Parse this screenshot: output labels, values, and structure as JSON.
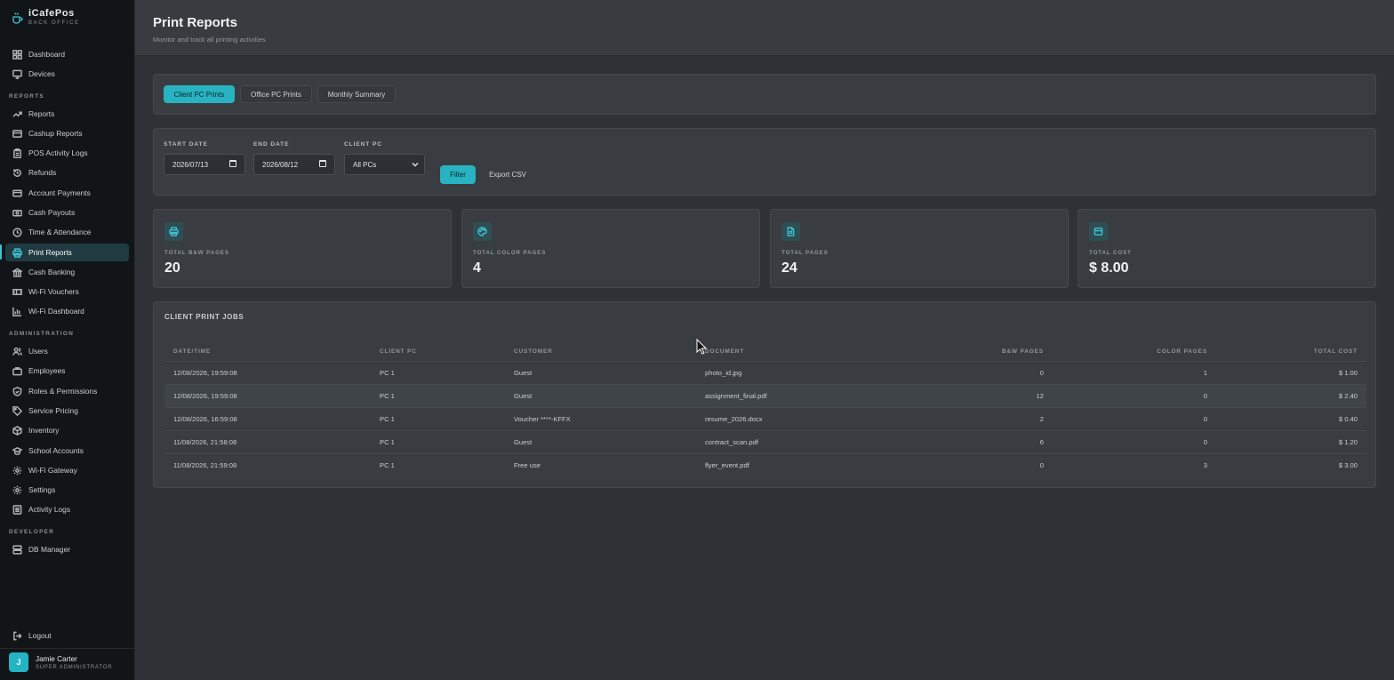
{
  "app": {
    "name": "iCafePos",
    "subtitle": "BACK OFFICE"
  },
  "sidebar": {
    "top_items": [
      {
        "label": "Dashboard",
        "icon": "dashboard-icon"
      },
      {
        "label": "Devices",
        "icon": "monitor-icon"
      }
    ],
    "sections": [
      {
        "label": "REPORTS",
        "items": [
          {
            "label": "Reports",
            "icon": "trending-up-icon"
          },
          {
            "label": "Cashup Reports",
            "icon": "wallet-icon"
          },
          {
            "label": "POS Activity Logs",
            "icon": "clipboard-icon"
          },
          {
            "label": "Refunds",
            "icon": "refund-icon"
          },
          {
            "label": "Account Payments",
            "icon": "credit-card-icon"
          },
          {
            "label": "Cash Payouts",
            "icon": "cash-icon"
          },
          {
            "label": "Time & Attendance",
            "icon": "clock-icon"
          },
          {
            "label": "Print Reports",
            "icon": "printer-icon",
            "active": true
          },
          {
            "label": "Cash Banking",
            "icon": "bank-icon"
          },
          {
            "label": "Wi-Fi Vouchers",
            "icon": "ticket-icon"
          },
          {
            "label": "Wi-Fi Dashboard",
            "icon": "bar-chart-icon"
          }
        ]
      },
      {
        "label": "ADMINISTRATION",
        "items": [
          {
            "label": "Users",
            "icon": "users-icon"
          },
          {
            "label": "Employees",
            "icon": "briefcase-icon"
          },
          {
            "label": "Roles & Permissions",
            "icon": "shield-icon"
          },
          {
            "label": "Service Pricing",
            "icon": "tag-icon"
          },
          {
            "label": "Inventory",
            "icon": "box-icon"
          },
          {
            "label": "School Accounts",
            "icon": "graduation-cap-icon"
          },
          {
            "label": "Wi-Fi Gateway",
            "icon": "gear-icon"
          },
          {
            "label": "Settings",
            "icon": "gear-icon"
          },
          {
            "label": "Activity Logs",
            "icon": "list-icon"
          }
        ]
      },
      {
        "label": "DEVELOPER",
        "items": [
          {
            "label": "DB Manager",
            "icon": "database-icon"
          }
        ]
      }
    ],
    "logout_label": "Logout",
    "user": {
      "initial": "J",
      "name": "Jamie Carter",
      "role": "SUPER ADMINISTRATOR"
    }
  },
  "header": {
    "title": "Print Reports",
    "subtitle": "Monitor and track all printing activities"
  },
  "tabs": [
    {
      "label": "Client PC Prints",
      "active": true
    },
    {
      "label": "Office PC Prints",
      "active": false
    },
    {
      "label": "Monthly Summary",
      "active": false
    }
  ],
  "filters": {
    "start_date": {
      "label": "START DATE",
      "value": "2026/07/13"
    },
    "end_date": {
      "label": "END DATE",
      "value": "2026/08/12"
    },
    "client_pc": {
      "label": "CLIENT PC",
      "value": "All PCs"
    },
    "filter_label": "Filter",
    "export_label": "Export CSV"
  },
  "stats": [
    {
      "label": "TOTAL B&W PAGES",
      "value": "20",
      "icon": "printer-icon"
    },
    {
      "label": "TOTAL COLOR PAGES",
      "value": "4",
      "icon": "palette-icon"
    },
    {
      "label": "TOTAL PAGES",
      "value": "24",
      "icon": "file-icon"
    },
    {
      "label": "TOTAL COST",
      "value": "$ 8.00",
      "icon": "wallet-icon"
    }
  ],
  "table": {
    "title": "CLIENT PRINT JOBS",
    "columns": [
      "DATE/TIME",
      "CLIENT PC",
      "CUSTOMER",
      "DOCUMENT",
      "B&W PAGES",
      "COLOR PAGES",
      "TOTAL COST"
    ],
    "rows": [
      [
        "12/08/2026, 19:59:08",
        "PC 1",
        "Guest",
        "photo_id.jpg",
        "0",
        "1",
        "$ 1.00"
      ],
      [
        "12/08/2026, 19:59:08",
        "PC 1",
        "Guest",
        "assignment_final.pdf",
        "12",
        "0",
        "$ 2.40"
      ],
      [
        "12/08/2026, 16:59:08",
        "PC 1",
        "Voucher ****-KFFX",
        "resume_2026.docx",
        "2",
        "0",
        "$ 0.40"
      ],
      [
        "11/08/2026, 21:58:08",
        "PC 1",
        "Guest",
        "contract_scan.pdf",
        "6",
        "0",
        "$ 1.20"
      ],
      [
        "11/08/2026, 21:59:08",
        "PC 1",
        "Free use",
        "flyer_event.pdf",
        "0",
        "3",
        "$ 3.00"
      ]
    ]
  },
  "colors": {
    "accent": "#27b3c2",
    "sidebar_bg": "#121518",
    "main_bg": "#2e3236"
  }
}
